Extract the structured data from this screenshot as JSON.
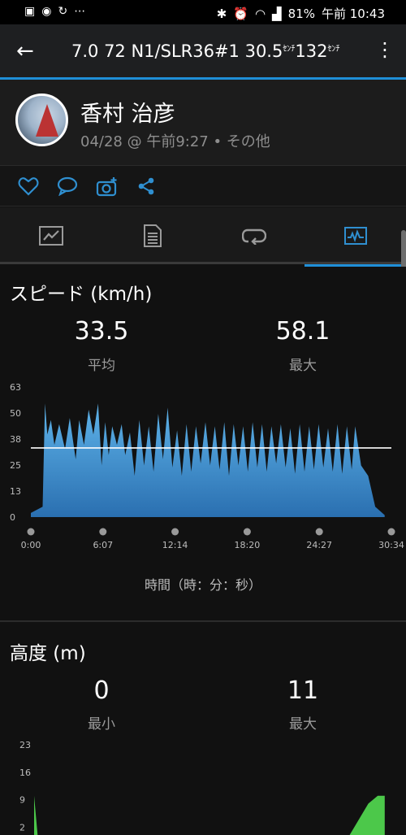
{
  "status_bar": {
    "battery": "81%",
    "time": "午前 10:43"
  },
  "app_bar": {
    "title_main": "7.0 72 N1/SLR36#1 30.5",
    "title_unit1": "ｾﾝﾁ",
    "title_mid": "132",
    "title_unit2": "ｾﾝﾁ"
  },
  "profile": {
    "name": "香村 治彦",
    "meta": "04/28 @ 午前9:27 • その他"
  },
  "actions": [
    "heart-icon",
    "comment-icon",
    "camera-plus-icon",
    "share-icon"
  ],
  "tabs": [
    {
      "name": "tab-overview",
      "icon": "overview-icon"
    },
    {
      "name": "tab-details",
      "icon": "details-icon"
    },
    {
      "name": "tab-laps",
      "icon": "laps-icon"
    },
    {
      "name": "tab-charts",
      "icon": "chart-icon",
      "active": true
    }
  ],
  "speed": {
    "heading": "スピード (km/h)",
    "avg_value": "33.5",
    "avg_label": "平均",
    "max_value": "58.1",
    "max_label": "最大",
    "x_axis_label": "時間（時：分：秒）"
  },
  "altitude": {
    "heading": "高度 (m)",
    "min_value": "0",
    "min_label": "最小",
    "max_value": "11",
    "max_label": "最大"
  },
  "chart_data": [
    {
      "type": "area",
      "title": "スピード (km/h)",
      "xlabel": "時間（時：分：秒）",
      "ylabel": "",
      "y_ticks": [
        "0",
        "13",
        "25",
        "38",
        "50",
        "63"
      ],
      "ylim": [
        0,
        63
      ],
      "x_ticks": [
        "0:00",
        "6:07",
        "12:14",
        "18:20",
        "24:27",
        "30:34"
      ],
      "xlim_min": [
        0,
        30.57
      ],
      "average_line": 33.5,
      "color": "#2f8fd0",
      "series": [
        {
          "x_min": [
            0,
            1.0,
            1.2,
            1.4,
            1.7,
            2.0,
            2.4,
            2.9,
            3.3,
            3.8,
            4.1,
            4.5,
            4.9,
            5.3,
            5.7,
            6.0,
            6.3,
            6.6,
            6.9,
            7.3,
            7.7,
            8.0,
            8.4,
            8.8,
            9.2,
            9.6,
            10.0,
            10.4,
            10.8,
            11.2,
            11.6,
            12.0,
            12.4,
            12.8,
            13.2,
            13.6,
            14.0,
            14.4,
            14.8,
            15.2,
            15.6,
            16.0,
            16.4,
            16.8,
            17.2,
            17.6,
            18.0,
            18.4,
            18.8,
            19.2,
            19.6,
            20.0,
            20.4,
            20.8,
            21.2,
            21.6,
            22.0,
            22.4,
            22.8,
            23.2,
            23.6,
            24.0,
            24.4,
            24.8,
            25.2,
            25.6,
            26.0,
            26.4,
            26.8,
            27.2,
            27.5,
            28.0,
            28.6,
            29.2,
            30.0
          ],
          "y": [
            2,
            5,
            55,
            40,
            47,
            35,
            45,
            33,
            48,
            28,
            47,
            35,
            52,
            40,
            55,
            25,
            46,
            30,
            44,
            35,
            45,
            30,
            41,
            20,
            47,
            25,
            44,
            22,
            50,
            28,
            53,
            24,
            42,
            20,
            45,
            22,
            44,
            26,
            46,
            25,
            44,
            23,
            46,
            20,
            45,
            25,
            44,
            22,
            46,
            24,
            45,
            22,
            44,
            26,
            45,
            24,
            43,
            21,
            45,
            22,
            44,
            23,
            45,
            24,
            43,
            22,
            45,
            21,
            44,
            23,
            44,
            25,
            20,
            5,
            1
          ]
        }
      ]
    },
    {
      "type": "area",
      "title": "高度 (m)",
      "y_ticks": [
        "2",
        "9",
        "16",
        "23"
      ],
      "ylim": [
        0,
        23
      ],
      "color": "#4cc84a",
      "series": [
        {
          "x_min": [
            0,
            0.3,
            1.0,
            27.0,
            28.6,
            29.4,
            30.0
          ],
          "y": [
            10,
            0,
            0,
            0,
            8,
            10,
            10
          ]
        }
      ]
    }
  ]
}
